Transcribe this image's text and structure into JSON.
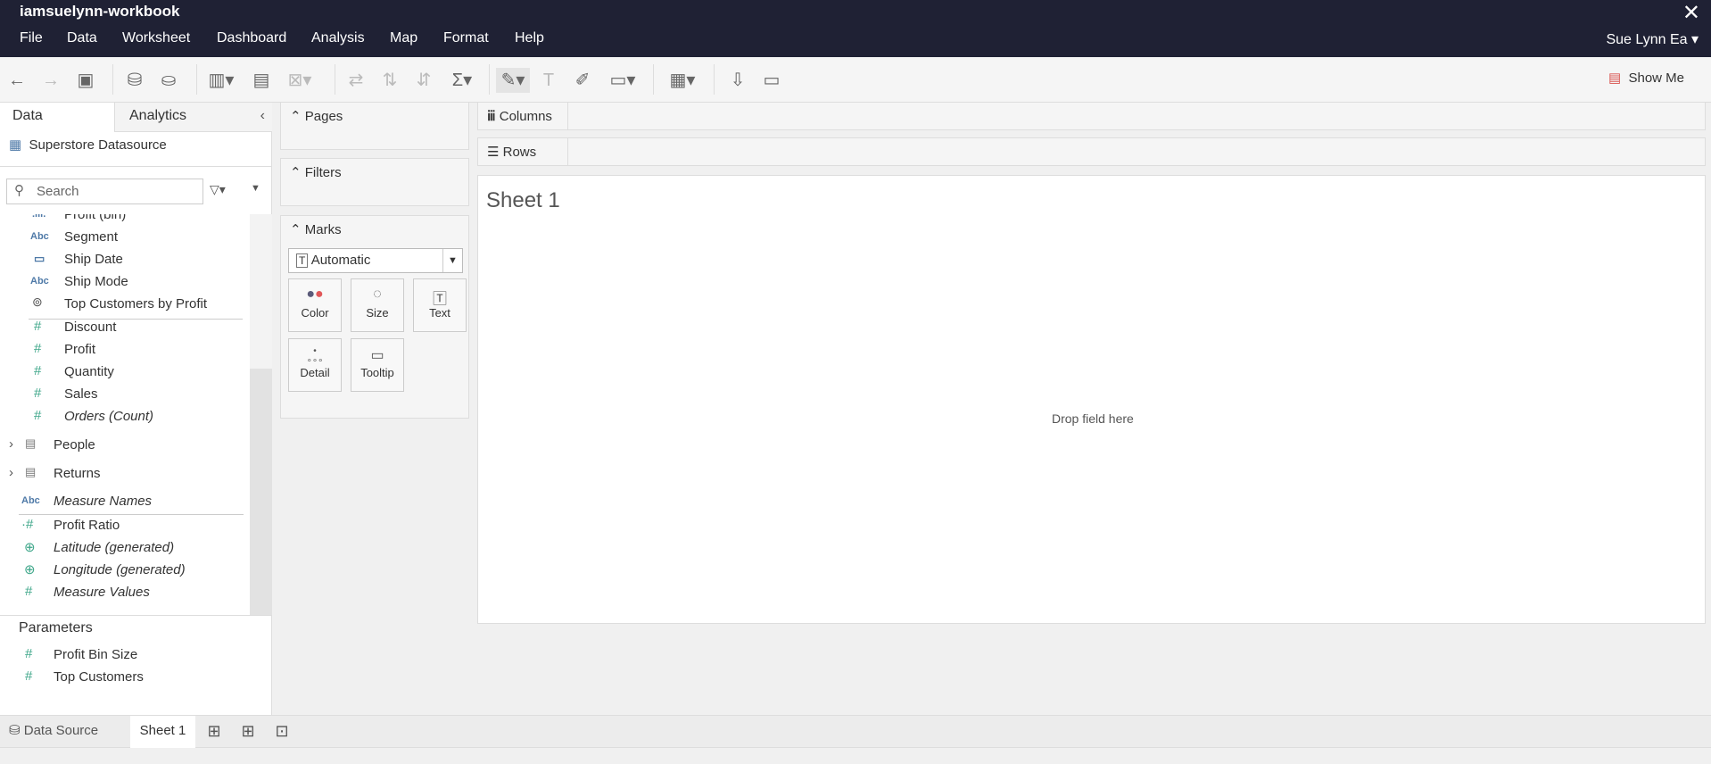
{
  "window": {
    "title": "iamsuelynn-workbook",
    "user": "Sue Lynn Ea"
  },
  "menu": [
    "File",
    "Data",
    "Worksheet",
    "Dashboard",
    "Analysis",
    "Map",
    "Format",
    "Help"
  ],
  "toolbar": {
    "show_me": "Show Me"
  },
  "left": {
    "tabs": [
      "Data",
      "Analytics"
    ],
    "datasource": "Superstore Datasource",
    "search_placeholder": "Search",
    "fields": [
      {
        "icon": "bin",
        "label": "Profit (bin)"
      },
      {
        "icon": "Abc",
        "label": "Segment"
      },
      {
        "icon": "date",
        "label": "Ship Date"
      },
      {
        "icon": "Abc",
        "label": "Ship Mode"
      },
      {
        "icon": "set",
        "label": "Top Customers by Profit"
      },
      {
        "icon": "#",
        "label": "Discount"
      },
      {
        "icon": "#",
        "label": "Profit"
      },
      {
        "icon": "#",
        "label": "Quantity"
      },
      {
        "icon": "#",
        "label": "Sales"
      },
      {
        "icon": "#",
        "label": "Orders (Count)"
      }
    ],
    "tables": [
      "People",
      "Returns"
    ],
    "measure_names": "Measure Names",
    "extra": [
      "Profit Ratio",
      "Latitude (generated)",
      "Longitude (generated)",
      "Measure Values"
    ],
    "parameters_header": "Parameters",
    "parameters": [
      "Profit Bin Size",
      "Top Customers"
    ]
  },
  "cards": {
    "pages": "Pages",
    "filters": "Filters",
    "marks": "Marks",
    "mark_type": "Automatic",
    "mark_buttons": [
      "Color",
      "Size",
      "Text",
      "Detail",
      "Tooltip"
    ]
  },
  "shelves": {
    "columns": "Columns",
    "rows": "Rows"
  },
  "sheet": {
    "title": "Sheet 1",
    "drop": "Drop field here"
  },
  "bottom": {
    "data_source": "Data Source",
    "sheet": "Sheet 1"
  }
}
